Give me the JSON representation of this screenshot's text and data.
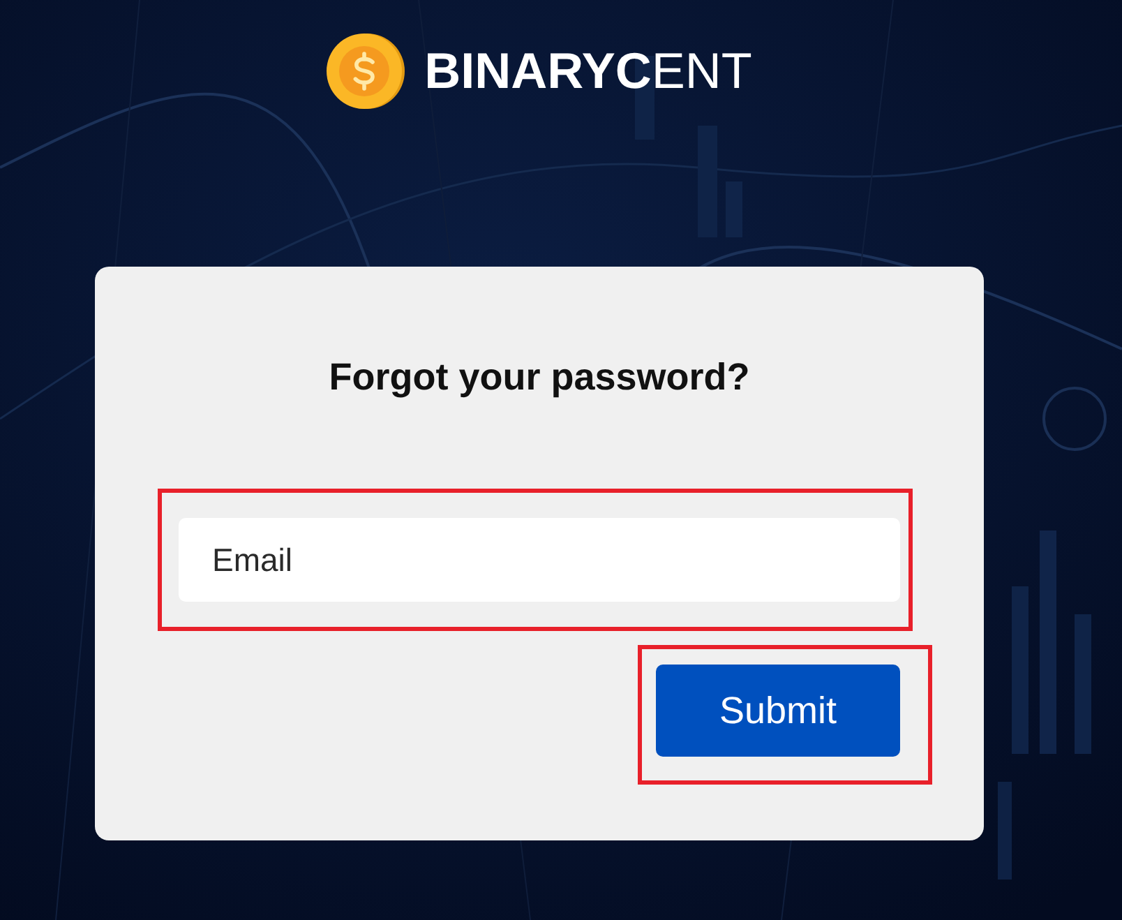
{
  "logo": {
    "text": "**BINARYC**ENT"
  },
  "card": {
    "title": "Forgot your password?",
    "email_field": {
      "placeholder": "Email",
      "highlighted": true
    },
    "submit_button": {
      "label": "Submit",
      "highlighted": true
    }
  }
}
